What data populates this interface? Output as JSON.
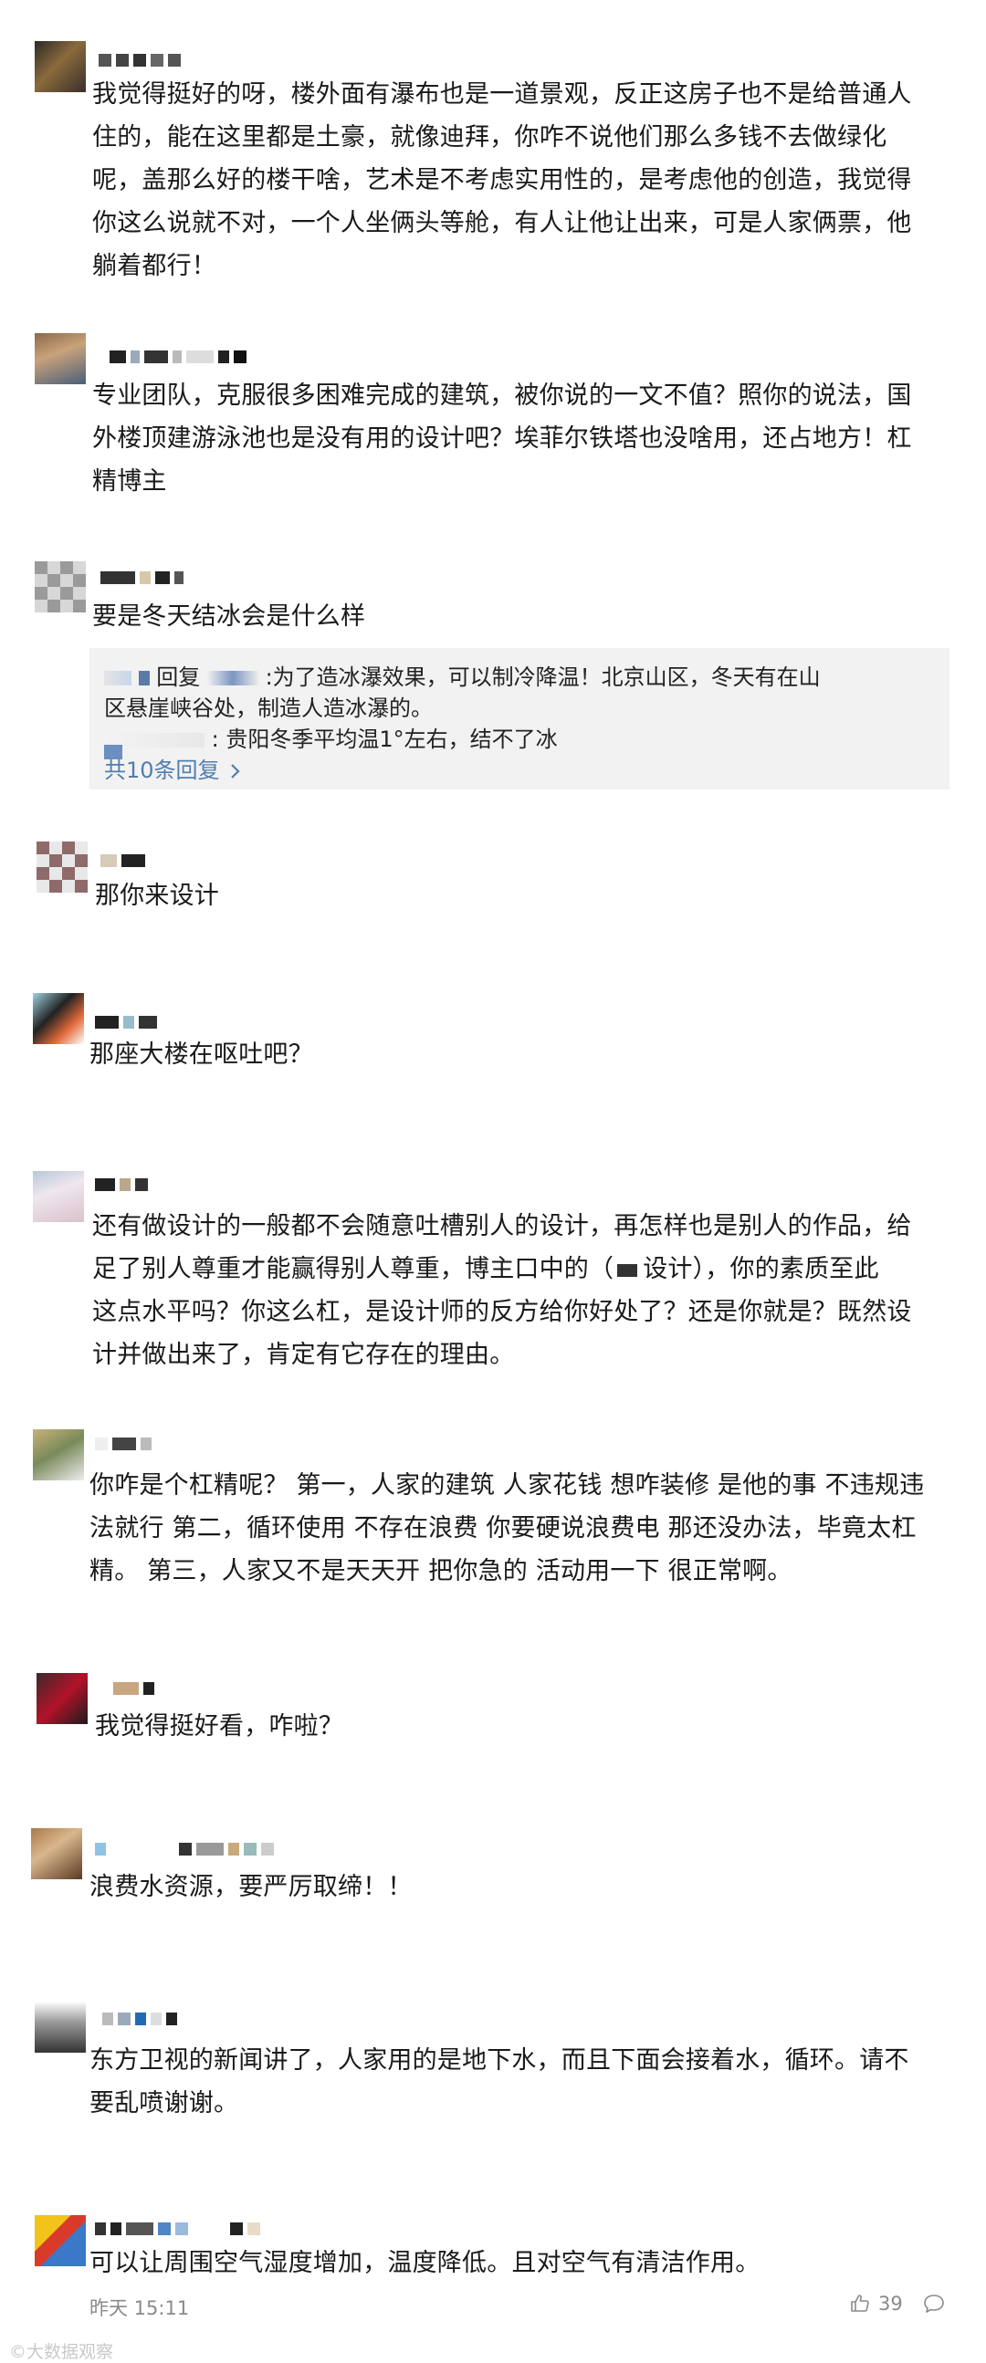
{
  "comments": [
    {
      "lines": [
        "我觉得挺好的呀，楼外面有瀑布也是一道景观，反正这房子也不是给普通人",
        "住的，能在这里都是土豪，就像迪拜，你咋不说他们那么多钱不去做绿化",
        "呢，盖那么好的楼干啥，艺术是不考虑实用性的，是考虑他的创造，我觉得",
        "你这么说就不对，一个人坐俩头等舱，有人让他让出来，可是人家俩票，他",
        "躺着都行！"
      ]
    },
    {
      "lines": [
        "专业团队，克服很多困难完成的建筑，被你说的一文不值？照你的说法，国",
        "外楼顶建游泳池也是没有用的设计吧？埃菲尔铁塔也没啥用，还占地方！杠",
        "精博主"
      ]
    },
    {
      "lines": [
        "要是冬天结冰会是什么样"
      ],
      "replies": {
        "reply_word": "回复",
        "line1_text": ":为了造冰瀑效果，可以制冷降温！北京山区，冬天有在山",
        "line2_text": "区悬崖峡谷处，制造人造冰瀑的。",
        "line3_text": ": 贵阳冬季平均温1°左右，结不了冰",
        "more": "共10条回复",
        "more_icon": "chevron-right-icon"
      }
    },
    {
      "lines": [
        "那你来设计"
      ]
    },
    {
      "lines": [
        "那座大楼在呕吐吧？"
      ]
    },
    {
      "lines": [
        "还有做设计的一般都不会随意吐槽别人的设计，再怎样也是别人的作品，给",
        "足了别人尊重才能赢得别人尊重，博主口中的（",
        "这点水平吗？你这么杠，是设计师的反方给你好处了？还是你就是？既然设",
        "计并做出来了，肯定有它存在的理由。"
      ],
      "line2_suffix": "设计），你的素质至此"
    },
    {
      "lines": [
        "你咋是个杠精呢？ 第一，人家的建筑 人家花钱 想咋装修 是他的事 不违规违",
        "法就行 第二，循环使用 不存在浪费 你要硬说浪费电 那还没办法，毕竟太杠",
        "精。 第三，人家又不是天天开 把你急的 活动用一下 很正常啊。"
      ]
    },
    {
      "lines": [
        "我觉得挺好看，咋啦？"
      ]
    },
    {
      "lines": [
        "浪费水资源，要严厉取缔！！"
      ]
    },
    {
      "lines": [
        "东方卫视的新闻讲了，人家用的是地下水，而且下面会接着水，循环。请不",
        "要乱喷谢谢。"
      ]
    },
    {
      "lines": [
        "可以让周围空气湿度增加，温度降低。且对空气有清洁作用。"
      ],
      "meta": {
        "time": "昨天 15:11",
        "likes": "39",
        "like_icon": "thumbs-up-icon",
        "comment_icon": "comment-bubble-icon"
      }
    }
  ],
  "watermark": "©大数据观察",
  "colors": {
    "link": "#507daf",
    "meta": "#8a8a8a",
    "reply_bg": "#f2f2f2",
    "text": "#1a1a1a"
  }
}
